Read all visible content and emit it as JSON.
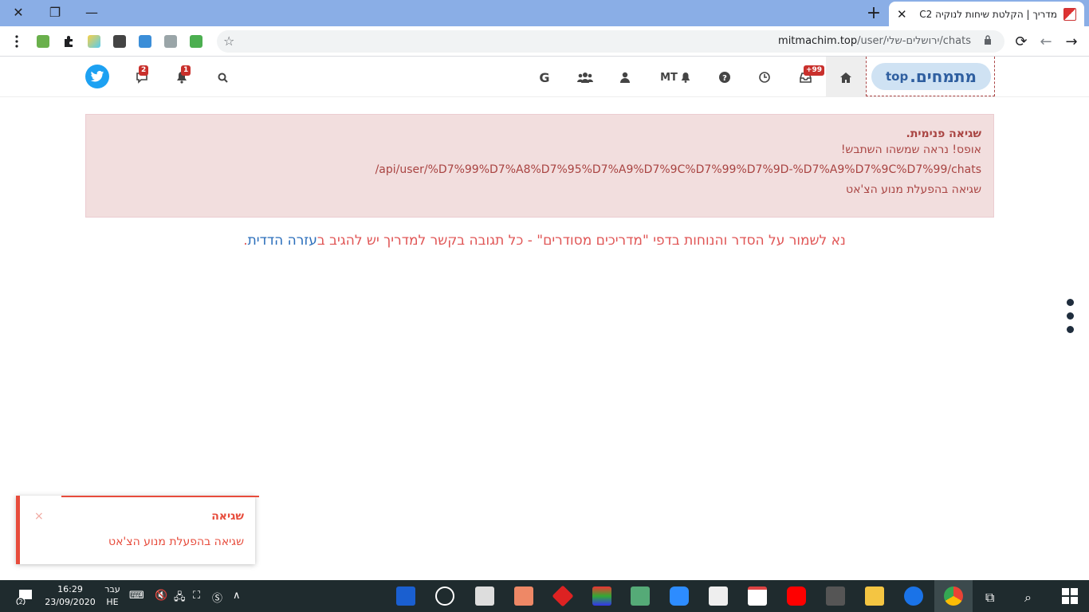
{
  "browser": {
    "tab_title": "מדריך | הקלטת שיחות לנוקיה C2",
    "tab_close": "✕",
    "new_tab": "+",
    "url_host": "mitmachim.top",
    "url_path": "/user/ירושלים-שלי/chats",
    "win_close": "✕",
    "win_restore": "❐",
    "win_minimize": "—"
  },
  "site": {
    "logo_text": "מתמחים.",
    "logo_suffix": "top",
    "nav_mt_label": "MT",
    "nav_google_label": "G",
    "badge_inbox": "+99",
    "badge_notifications": "1",
    "badge_chats": "2"
  },
  "alert": {
    "heading": "שגיאה פנימית.",
    "line1": "אופס! נראה שמשהו השתבש!",
    "line2": "/api/user/%D7%99%D7%A8%D7%95%D7%A9%D7%9C%D7%99%D7%9D-%D7%A9%D7%9C%D7%99/chats",
    "line3": "שגיאה בהפעלת מנוע הצ'אט"
  },
  "notice": {
    "text": "נא לשמור על הסדר והנוחות בדפי \"מדריכים מסודרים\" - כל תגובה בקשר למדריך יש להגיב ב",
    "link": "עזרה הדדית",
    "end": "."
  },
  "toast": {
    "title": "שגיאה",
    "message": "שגיאה בהפעלת מנוע הצ'אט",
    "close": "×"
  },
  "taskbar": {
    "time": "16:29",
    "date": "23/09/2020",
    "lang_top": "עבר",
    "lang_bottom": "HE",
    "notif_count": "2"
  },
  "colors": {
    "tabstrip": "#8aaee6",
    "alert_bg": "#f2dede",
    "alert_text": "#a94442",
    "error_red": "#e74c3c",
    "badge_red": "#c9302c",
    "twitter_blue": "#1da1f2",
    "taskbar": "#1f2b2e"
  }
}
